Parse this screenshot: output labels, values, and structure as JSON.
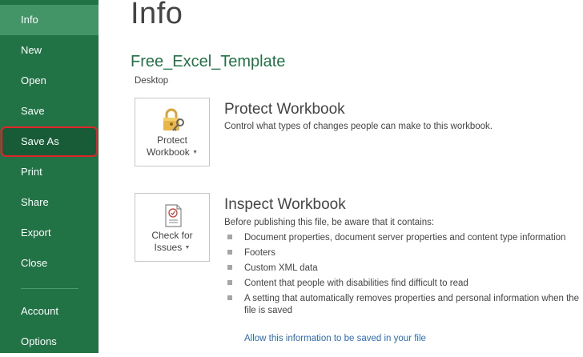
{
  "sidebar": {
    "items": [
      {
        "label": "Info",
        "active": true
      },
      {
        "label": "New"
      },
      {
        "label": "Open"
      },
      {
        "label": "Save"
      },
      {
        "label": "Save As",
        "highlighted": true
      },
      {
        "label": "Print"
      },
      {
        "label": "Share"
      },
      {
        "label": "Export"
      },
      {
        "label": "Close"
      },
      {
        "label": "Account"
      },
      {
        "label": "Options"
      }
    ],
    "colors": {
      "background": "#217346",
      "active": "#439467",
      "highlight_border": "#e0242a"
    }
  },
  "main": {
    "title": "Info",
    "document_name": "Free_Excel_Template",
    "document_location": "Desktop",
    "protect": {
      "button_line1": "Protect",
      "button_line2": "Workbook",
      "icon": "lock-key-icon",
      "heading": "Protect Workbook",
      "description": "Control what types of changes people can make to this workbook."
    },
    "inspect": {
      "button_line1": "Check for",
      "button_line2": "Issues",
      "icon": "document-check-icon",
      "heading": "Inspect Workbook",
      "intro": "Before publishing this file, be aware that it contains:",
      "bullets": [
        "Document properties, document server properties and content type information",
        "Footers",
        "Custom XML data",
        "Content that people with disabilities find difficult to read",
        "A setting that automatically removes properties and personal information when the file is saved"
      ],
      "link": "Allow this information to be saved in your file"
    }
  }
}
